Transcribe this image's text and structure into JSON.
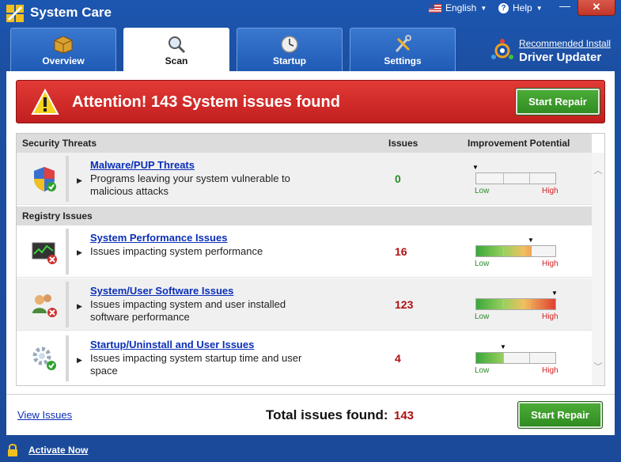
{
  "window": {
    "title": "System Care"
  },
  "titlebar": {
    "language_label": "English",
    "help_label": "Help",
    "minimize_glyph": "—",
    "close_glyph": "✕"
  },
  "tabs": [
    {
      "label": "Overview",
      "icon": "box-icon"
    },
    {
      "label": "Scan",
      "icon": "magnifier-icon",
      "active": true
    },
    {
      "label": "Startup",
      "icon": "clock-icon"
    },
    {
      "label": "Settings",
      "icon": "tools-icon"
    }
  ],
  "promo": {
    "link_text": "Recommended Install",
    "title": "Driver Updater"
  },
  "alert": {
    "text": "Attention! 143 System issues found",
    "button_label": "Start Repair"
  },
  "grid": {
    "section_security": "Security Threats",
    "col_issues": "Issues",
    "col_potential": "Improvement Potential",
    "section_registry": "Registry Issues",
    "low_label": "Low",
    "high_label": "High",
    "rows": [
      {
        "title": "Malware/PUP Threats",
        "description": "Programs leaving your system vulnerable to malicious attacks",
        "count": "0",
        "count_color": "#2a8a2a",
        "potential": 0.0
      },
      {
        "title": "System Performance Issues",
        "description": "Issues impacting system performance",
        "count": "16",
        "count_color": "#b01010",
        "potential": 0.7
      },
      {
        "title": "System/User Software Issues",
        "description": "Issues impacting system and user installed software performance",
        "count": "123",
        "count_color": "#b01010",
        "potential": 1.0
      },
      {
        "title": "Startup/Uninstall and User Issues",
        "description": "Issues impacting system startup time and user space",
        "count": "4",
        "count_color": "#b01010",
        "potential": 0.35
      }
    ]
  },
  "footer": {
    "view_issues": "View Issues",
    "total_label": "Total issues found:",
    "total_value": "143",
    "button_label": "Start Repair"
  },
  "bottombar": {
    "activate_label": "Activate Now"
  }
}
